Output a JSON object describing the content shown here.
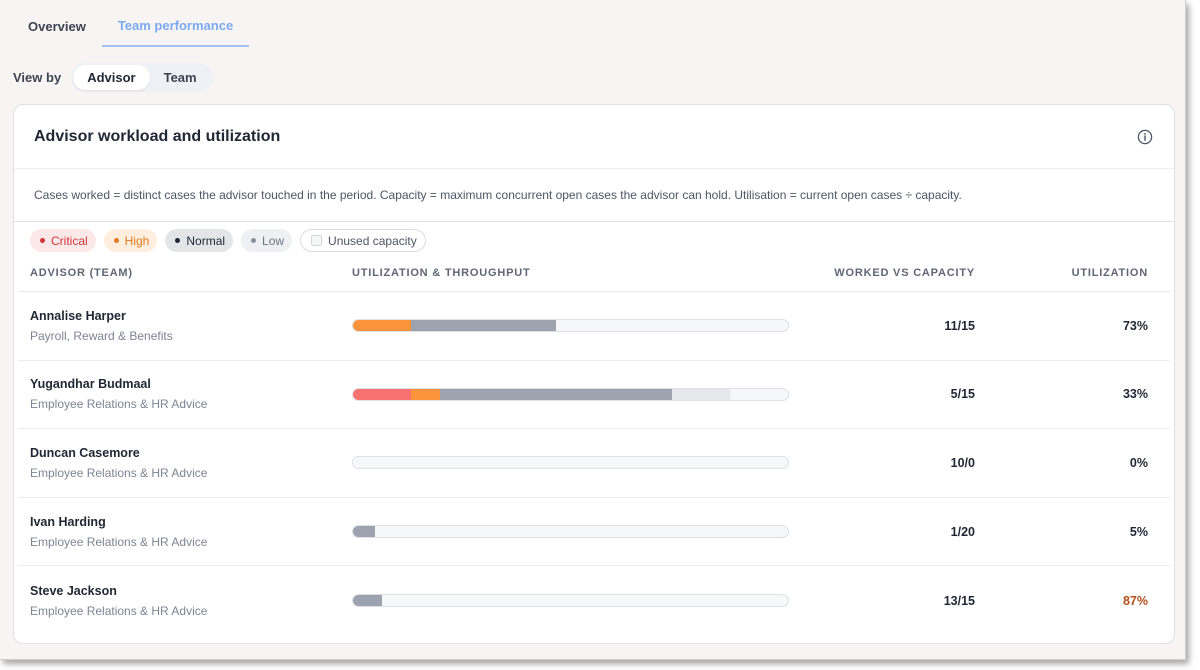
{
  "tabs": [
    {
      "label": "Overview",
      "active": false
    },
    {
      "label": "Team performance",
      "active": true
    }
  ],
  "view_by": {
    "label": "View by",
    "options": [
      {
        "label": "Advisor",
        "active": true
      },
      {
        "label": "Team",
        "active": false
      }
    ]
  },
  "card": {
    "title": "Advisor workload and utilization",
    "info_icon": "info-icon",
    "description": "Cases worked = distinct cases the advisor touched in the period. Capacity = maximum concurrent open cases the advisor can hold. Utilisation = current open cases ÷ capacity.",
    "legend": {
      "critical": "Critical",
      "high": "High",
      "normal": "Normal",
      "low": "Low",
      "unused": "Unused capacity"
    },
    "columns": {
      "advisor": "ADVISOR (TEAM)",
      "bar": "UTILIZATION & THROUGHPUT",
      "worked": "WORKED VS CAPACITY",
      "util": "UTILIZATION"
    },
    "rows": [
      {
        "name": "Annalise Harper",
        "team": "Payroll, Reward & Benefits",
        "worked": "11/15",
        "util": "73%",
        "util_color": "#1f2733",
        "segments": [
          {
            "level": "high",
            "fraction": 0.133
          },
          {
            "level": "normal",
            "fraction": 0.333
          }
        ]
      },
      {
        "name": "Yugandhar Budmaal",
        "team": "Employee Relations & HR Advice",
        "worked": "5/15",
        "util": "33%",
        "util_color": "#1f2733",
        "segments": [
          {
            "level": "critical",
            "fraction": 0.133
          },
          {
            "level": "high",
            "fraction": 0.067
          },
          {
            "level": "normal",
            "fraction": 0.533
          },
          {
            "level": "low",
            "fraction": 0.133
          }
        ]
      },
      {
        "name": "Duncan Casemore",
        "team": "Employee Relations & HR Advice",
        "worked": "10/0",
        "util": "0%",
        "util_color": "#1f2733",
        "segments": []
      },
      {
        "name": "Ivan Harding",
        "team": "Employee Relations & HR Advice",
        "worked": "1/20",
        "util": "5%",
        "util_color": "#1f2733",
        "segments": [
          {
            "level": "normal",
            "fraction": 0.05
          }
        ]
      },
      {
        "name": "Steve Jackson",
        "team": "Employee Relations & HR Advice",
        "worked": "13/15",
        "util": "87%",
        "util_color": "#b3501f",
        "segments": [
          {
            "level": "normal",
            "fraction": 0.067
          }
        ]
      }
    ]
  },
  "colors": {
    "critical": "#f87171",
    "high": "#fb923c",
    "normal": "#9ca3af",
    "low": "#e5e7eb",
    "accent": "#7aaaf2"
  }
}
